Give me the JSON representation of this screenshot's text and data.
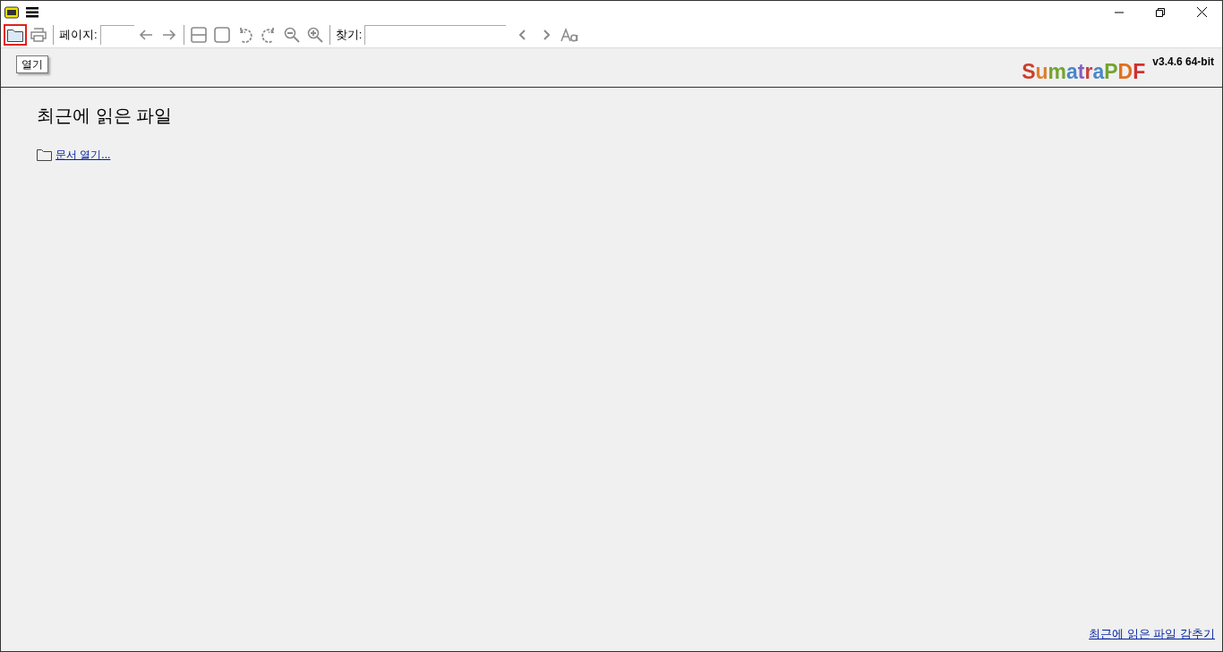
{
  "toolbar": {
    "open_button": {
      "highlighted": true
    },
    "page_label": "페이지:",
    "find_label": "찾기:"
  },
  "tooltip": "열기",
  "logo": {
    "text": "SumatraPDF",
    "version": "v3.4.6 64-bit"
  },
  "content": {
    "heading": "최근에 읽은 파일",
    "open_link": "문서 열기...",
    "hide_link": "최근에 읽은 파일 감추기"
  }
}
